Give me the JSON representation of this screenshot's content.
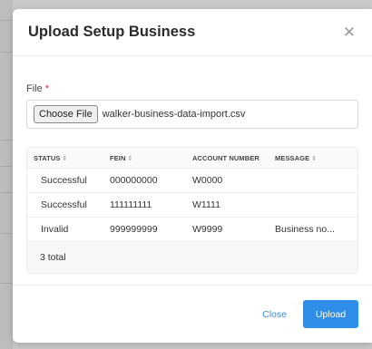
{
  "modal": {
    "title": "Upload Setup Business",
    "close_icon": "close-icon"
  },
  "file_field": {
    "label": "File",
    "required_mark": "*",
    "choose_button": "Choose File",
    "file_name": "walker-business-data-import.csv"
  },
  "table": {
    "columns": [
      "STATUS",
      "FEIN",
      "ACCOUNT NUMBER",
      "MESSAGE"
    ],
    "sortable_icon": "sort-icon",
    "rows": [
      {
        "status": "Successful",
        "fein": "000000000",
        "account_number": "W0000",
        "message": ""
      },
      {
        "status": "Successful",
        "fein": "111111111",
        "account_number": "W1111",
        "message": ""
      },
      {
        "status": "Invalid",
        "fein": "999999999",
        "account_number": "W9999",
        "message": "Business no..."
      }
    ],
    "total": "3 total"
  },
  "footer": {
    "close_label": "Close",
    "upload_label": "Upload"
  }
}
